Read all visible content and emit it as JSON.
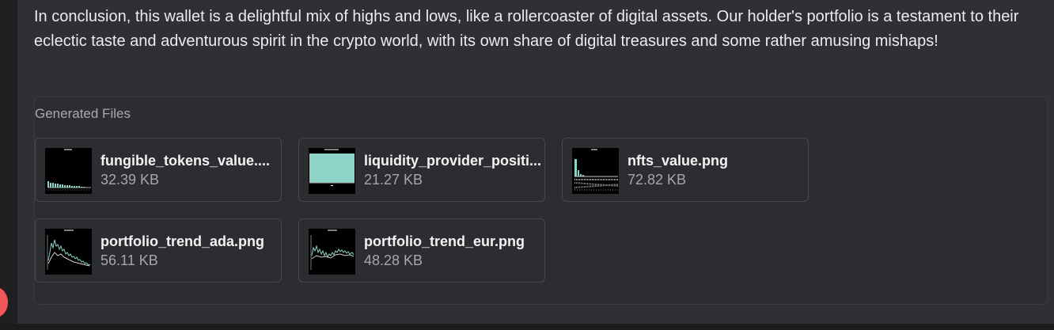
{
  "message": {
    "conclusion": "In conclusion, this wallet is a delightful mix of highs and lows, like a rollercoaster of digital assets. Our holder's portfolio is a testament to their eclectic taste and adventurous spirit in the crypto world, with its own share of digital treasures and some rather amusing mishaps!"
  },
  "generated_files": {
    "title": "Generated Files",
    "files": [
      {
        "name": "fungible_tokens_value....",
        "size": "32.39 KB",
        "icon": "bar-chart-thumbnail"
      },
      {
        "name": "liquidity_provider_positi...",
        "size": "21.27 KB",
        "icon": "bar-chart-thumbnail"
      },
      {
        "name": "nfts_value.png",
        "size": "72.82 KB",
        "icon": "bar-chart-thumbnail"
      },
      {
        "name": "portfolio_trend_ada.png",
        "size": "56.11 KB",
        "icon": "line-chart-thumbnail"
      },
      {
        "name": "portfolio_trend_eur.png",
        "size": "48.28 KB",
        "icon": "line-chart-thumbnail"
      }
    ]
  },
  "colors": {
    "page_background": "#2f3034",
    "thumbnail_accent": "#8dd3c7",
    "avatar_red": "#f0575a"
  }
}
